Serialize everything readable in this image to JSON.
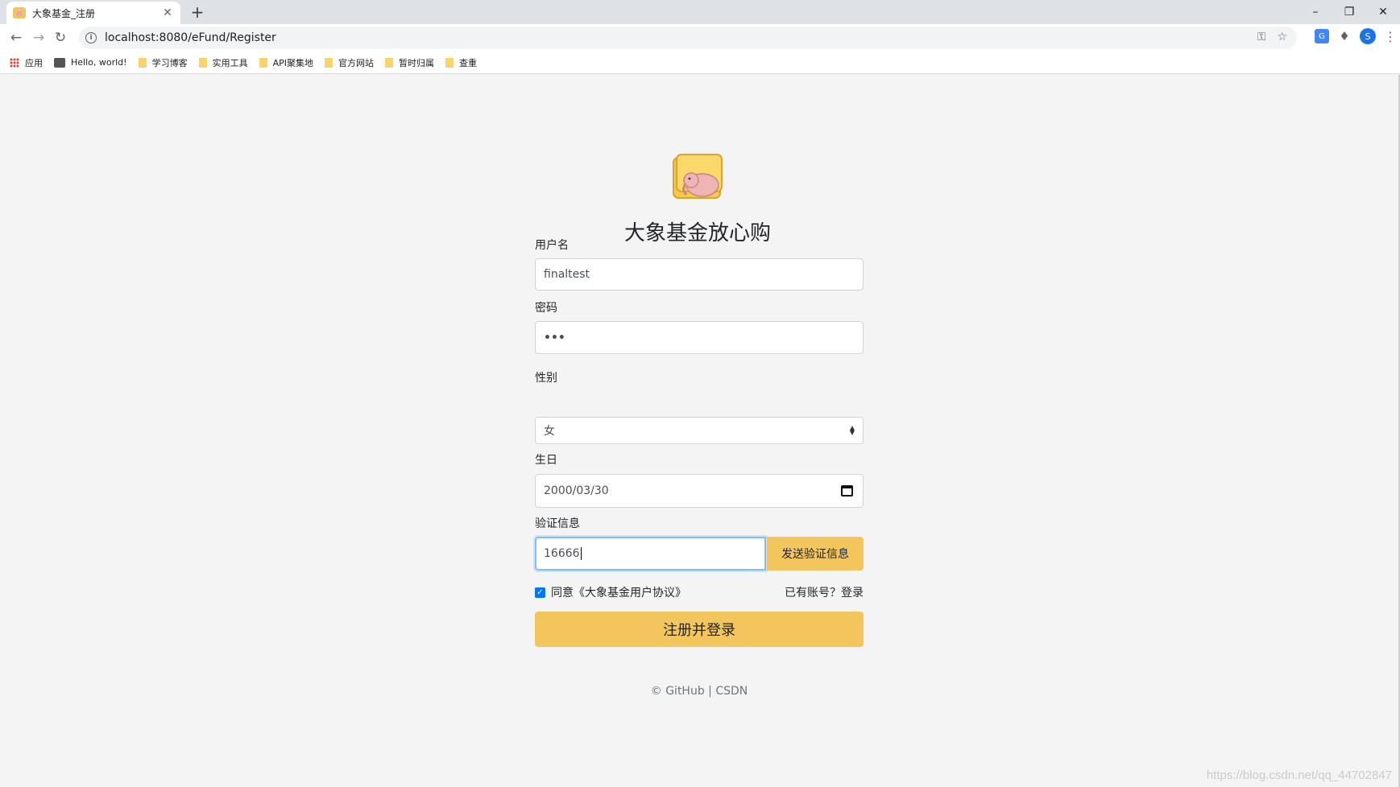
{
  "browser": {
    "tab_title": "大象基金_注册",
    "url": "localhost:8080/eFund/Register",
    "profile_initial": "S",
    "bookmarks": [
      {
        "label": "应用",
        "icon": "apps-grid-icon"
      },
      {
        "label": "Hello, world!",
        "icon": "hello-world-favicon"
      },
      {
        "label": "学习博客",
        "icon": "folder-icon"
      },
      {
        "label": "实用工具",
        "icon": "folder-icon"
      },
      {
        "label": "API聚集地",
        "icon": "folder-icon"
      },
      {
        "label": "官方网站",
        "icon": "folder-icon"
      },
      {
        "label": "暂时归属",
        "icon": "folder-icon"
      },
      {
        "label": "查重",
        "icon": "folder-icon"
      }
    ]
  },
  "page": {
    "title": "大象基金放心购",
    "form": {
      "username": {
        "label": "用户名",
        "value": "finaltest"
      },
      "password": {
        "label": "密码",
        "value": "•••"
      },
      "gender": {
        "label": "性别",
        "value": "女"
      },
      "birthday": {
        "label": "生日",
        "value": "2000/03/30"
      },
      "verify": {
        "label": "验证信息",
        "value": "16666",
        "button": "发送验证信息"
      },
      "agree_text": "同意《大象基金用户协议》",
      "agree_checked": true,
      "login_link": "已有账号？登录",
      "submit": "注册并登录"
    },
    "footer": "© GitHub | CSDN"
  },
  "watermark": "https://blog.csdn.net/qq_44702847",
  "colors": {
    "accent": "#f2c65d",
    "page_bg": "#f4f4f4",
    "focus_border": "#80bdff"
  }
}
